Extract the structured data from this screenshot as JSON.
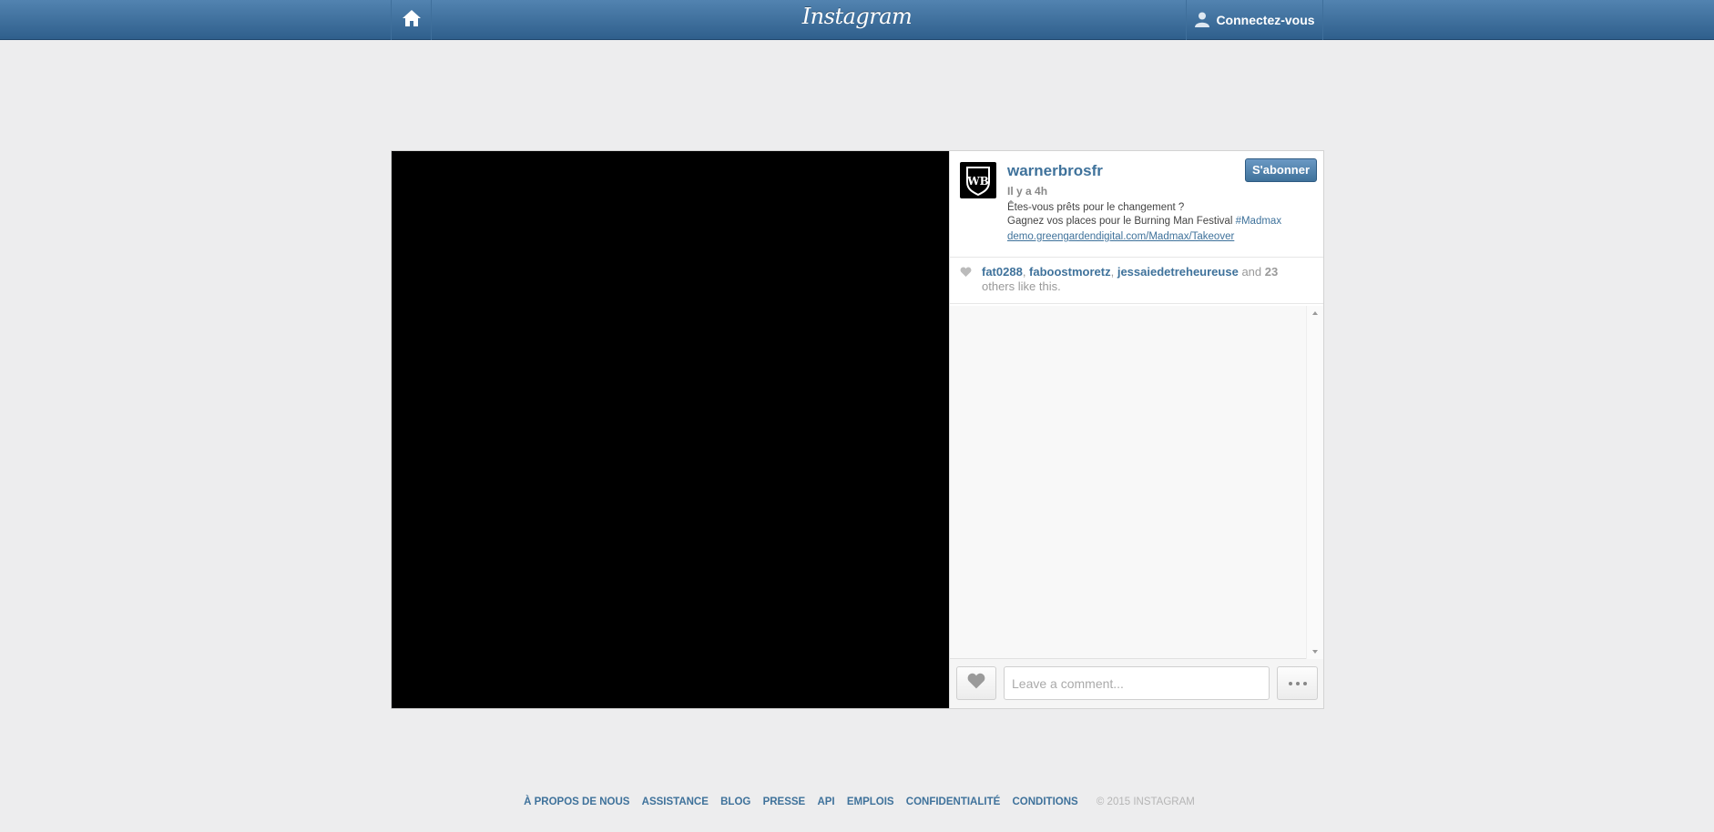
{
  "header": {
    "logo": "Instagram",
    "login_label": "Connectez-vous"
  },
  "post": {
    "username": "warnerbrosfr",
    "follow_label": "S'abonner",
    "time": "Il y a 4h",
    "caption_line1": "Êtes-vous prêts pour le changement ?",
    "caption_line2": "Gagnez vos places pour le Burning Man Festival ",
    "hashtag": "#Madmax",
    "link": "demo.greengardendigital.com/Madmax/Takeover",
    "likes": {
      "users": [
        "fat0288",
        "faboostmoretz",
        "jessaiedetreheureuse"
      ],
      "and": "and",
      "count": "23",
      "suffix": "others like this."
    },
    "comment_placeholder": "Leave a comment..."
  },
  "footer": {
    "links": [
      "À PROPOS DE NOUS",
      "ASSISTANCE",
      "BLOG",
      "PRESSE",
      "API",
      "EMPLOIS",
      "CONFIDENTIALITÉ",
      "CONDITIONS"
    ],
    "copyright": "© 2015 INSTAGRAM"
  }
}
